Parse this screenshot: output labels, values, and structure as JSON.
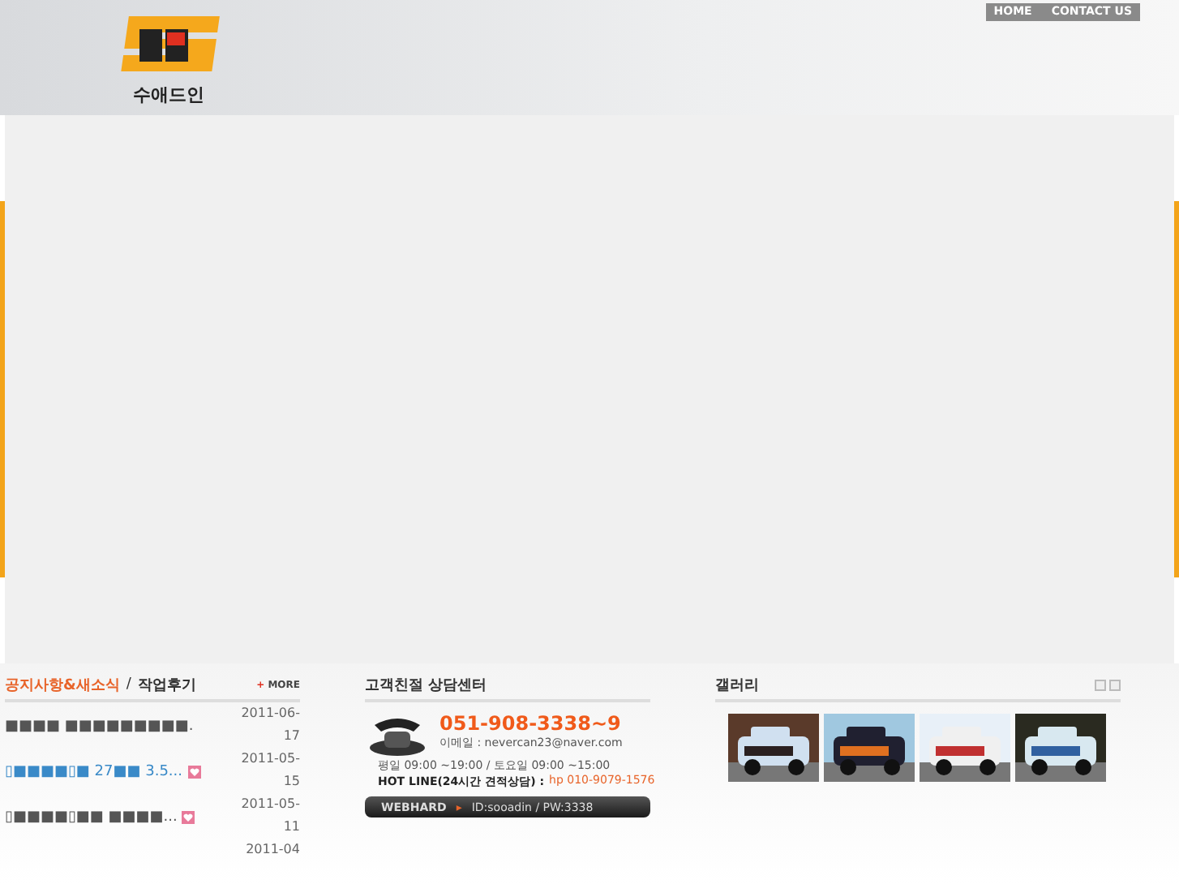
{
  "header": {
    "logo_text": "수애드인",
    "nav": [
      "HOME",
      "CONTACT US"
    ]
  },
  "notices": {
    "tabs": [
      {
        "label": "공지사항&새소식",
        "selected": true
      },
      {
        "label": "작업후기",
        "selected": false
      }
    ],
    "separator": "/",
    "more_icon": "+",
    "more": "MORE",
    "rows": [
      {
        "title": "■■■■ ■■■■■■■■■.",
        "date": "2011-06-17",
        "is_new": false,
        "link": false
      },
      {
        "title": "▯■■■■▯■ 27■■ 3.5...",
        "date": "2011-05-15",
        "is_new": true,
        "link": true
      },
      {
        "title": "▯■■■■▯■■ ■■■■...",
        "date": "2011-05-11",
        "is_new": true,
        "link": false
      },
      {
        "date": "2011-04"
      }
    ]
  },
  "consult": {
    "title": "고객친절 상담센터",
    "phone": "051-908-3338~9",
    "email": "이메일 : nevercan23@naver.com",
    "hours": "평일 09:00 ~19:00 / 토요일 09:00 ~15:00",
    "hotline_label": "HOT LINE(24시간 견적상담) :",
    "hotline": "hp 010-9079-1576",
    "webhard_label": "WEBHARD",
    "webhard_bullet": "▸",
    "webhard": "ID:sooadin / PW:3338"
  },
  "gallery": {
    "title": "갤러리"
  }
}
